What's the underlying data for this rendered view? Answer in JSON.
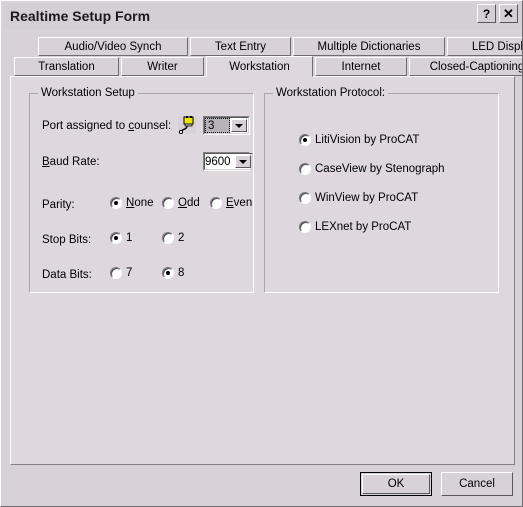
{
  "window": {
    "title": "Realtime Setup Form",
    "help_button": "?",
    "close_button": "✕",
    "icons": {
      "help": "question-mark-icon",
      "close": "close-x-icon",
      "port": "serial-plug-icon"
    },
    "colors": {
      "titlebar_bg": "#d4cfd4",
      "dialog_bg": "#d8d2d8",
      "tabpage_bg": "#ded8de",
      "text": "#000000",
      "groupbox_border": "#a9a5a9"
    }
  },
  "tabs": {
    "row1": [
      {
        "label": "Audio/Video Synch",
        "active": false
      },
      {
        "label": "Text Entry",
        "active": false
      },
      {
        "label": "Multiple Dictionaries",
        "active": false
      },
      {
        "label": "LED Display",
        "active": false
      }
    ],
    "row2": [
      {
        "label": "Translation",
        "active": false
      },
      {
        "label": "Writer",
        "active": false
      },
      {
        "label": "Workstation",
        "active": true
      },
      {
        "label": "Internet",
        "active": false
      },
      {
        "label": "Closed-Captioning",
        "active": false
      }
    ]
  },
  "workstation_setup": {
    "group_title": "Workstation  Setup",
    "port": {
      "label_pre": "Port assigned to ",
      "label_accel": "c",
      "label_post": "ounsel:",
      "value": "3",
      "focused": true
    },
    "baud_rate": {
      "label_accel": "B",
      "label_post": "aud Rate:",
      "value": "9600"
    },
    "parity": {
      "label": "Parity:",
      "options": [
        {
          "accel": "N",
          "rest": "one",
          "selected": true
        },
        {
          "accel": "O",
          "rest": "dd",
          "selected": false
        },
        {
          "accel": "E",
          "rest": "ven",
          "selected": false
        }
      ]
    },
    "stop_bits": {
      "label": "Stop Bits:",
      "options": [
        {
          "label": "1",
          "selected": true
        },
        {
          "label": "2",
          "selected": false
        }
      ]
    },
    "data_bits": {
      "label": "Data Bits:",
      "options": [
        {
          "label": "7",
          "selected": false
        },
        {
          "label": "8",
          "selected": true
        }
      ]
    }
  },
  "workstation_protocol": {
    "group_title": "Workstation Protocol:",
    "options": [
      {
        "label": "LitiVision by ProCAT",
        "selected": true
      },
      {
        "label": "CaseView by Stenograph",
        "selected": false
      },
      {
        "label": "WinView by ProCAT",
        "selected": false
      },
      {
        "label": "LEXnet by ProCAT",
        "selected": false
      }
    ]
  },
  "footer": {
    "ok_label": "OK",
    "cancel_label": "Cancel"
  }
}
